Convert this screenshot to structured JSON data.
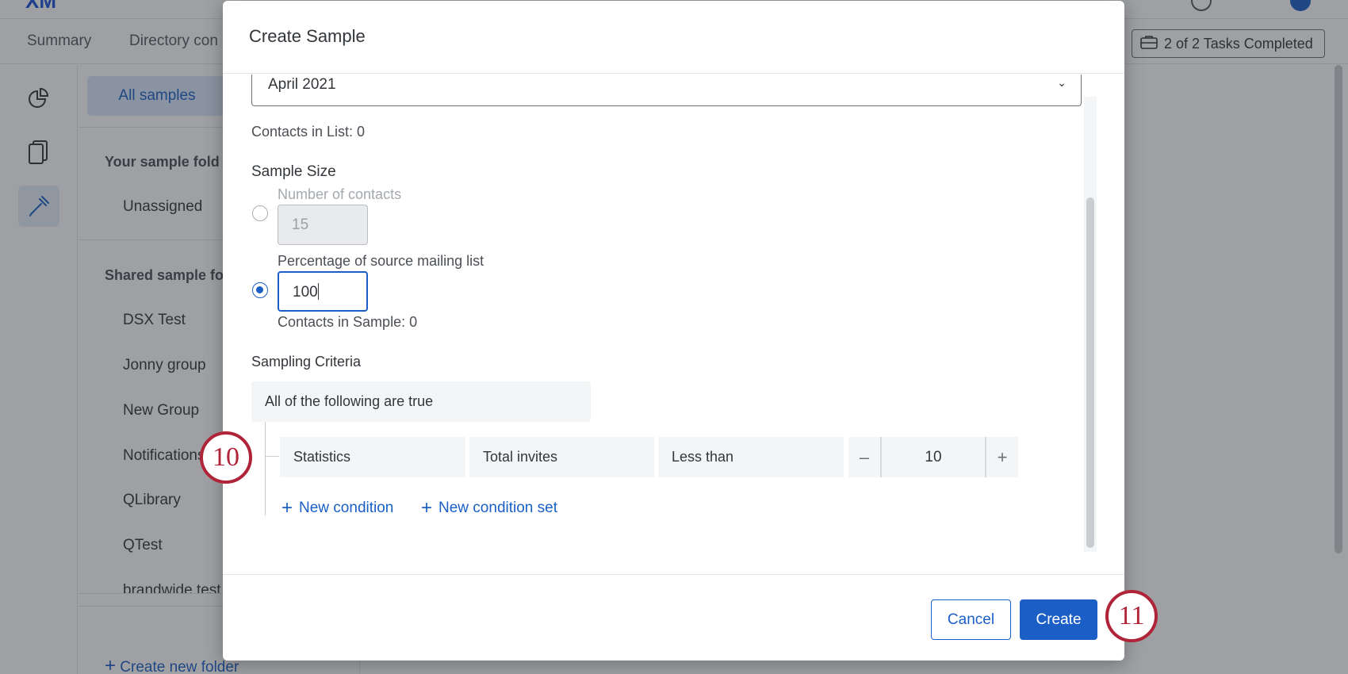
{
  "app": {
    "logo": "XM",
    "tabs": [
      "Summary",
      "Directory con"
    ],
    "tasks_label": "2 of 2 Tasks Completed"
  },
  "sidebar": {
    "all_samples": "All samples",
    "your_folders_title": "Your sample fold",
    "your_folders": [
      "Unassigned"
    ],
    "shared_folders_title": "Shared sample fo",
    "shared_folders": [
      "DSX Test",
      "Jonny group",
      "New Group",
      "Notifications",
      "QLibrary",
      "QTest",
      "brandwide test"
    ],
    "create_folder": "Create new folder"
  },
  "modal": {
    "title": "Create Sample",
    "source_list_value": "April 2021",
    "contacts_in_list": "Contacts in List: 0",
    "sample_size_title": "Sample Size",
    "number_of_contacts_label": "Number of contacts",
    "number_of_contacts_value": "15",
    "percentage_label": "Percentage of source mailing list",
    "percentage_value": "100",
    "contacts_in_sample": "Contacts in Sample: 0",
    "sampling_criteria_title": "Sampling Criteria",
    "criteria_header": "All of the following are true",
    "condition": {
      "field_1": "Statistics",
      "field_2": "Total invites",
      "operator": "Less than",
      "value": "10"
    },
    "new_condition": "New condition",
    "new_condition_set": "New condition set",
    "cancel": "Cancel",
    "create": "Create"
  },
  "callouts": [
    "10",
    "11"
  ],
  "colors": {
    "accent": "#1b5fc6",
    "callout": "#b0243a"
  }
}
